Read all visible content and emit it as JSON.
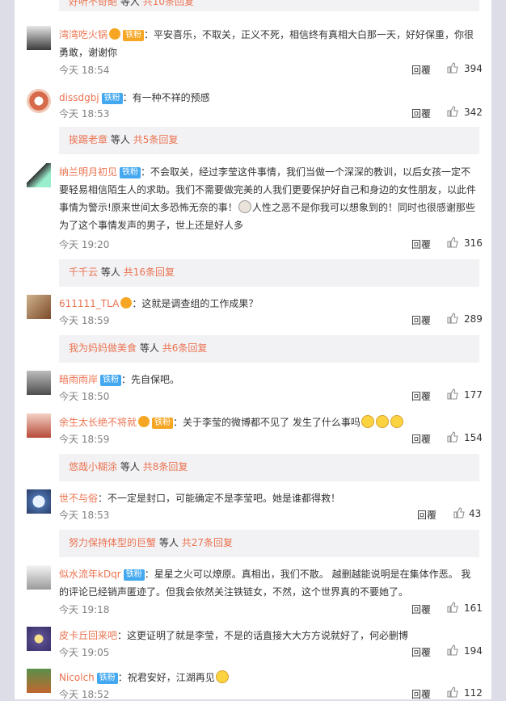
{
  "top_partial": {
    "name": "好听不奇葩",
    "mid": "等人",
    "count": "共10条回复"
  },
  "colors": {
    "accent": "#eb7350",
    "fan_badge": "#43a8f0",
    "gold_badge": "#f6a623"
  },
  "labels": {
    "reply": "回覆",
    "people": "等人"
  },
  "comments": [
    {
      "user": "湾湾吃火锅",
      "badge": "铁粉",
      "text": "：平安喜乐，不取关，正义不死，相信终有真相大白那一天，好好保重，你很勇敢，谢谢你",
      "time": "今天 18:54",
      "likes": "394"
    },
    {
      "user": "dissdgbj",
      "badge": "铁粉",
      "text": "：有一种不祥的预感",
      "time": "今天 18:53",
      "likes": "342"
    },
    {
      "user": "纳兰明月初见",
      "badge": "铁粉",
      "text": "：不会取关，经过李莹这件事情，我们当做一个深深的教训，以后女孩一定不要轻易相信陌生人的求助。我们不需要做完美的人我们更要保护好自己和身边的女性朋友，以此件事情为警示!原来世间太多恐怖无奈的事！",
      "text2": "人性之恶不是你我可以想象到的！同时也很感谢那些为了这个事情发声的男子，世上还是好人多",
      "time": "今天 19:20",
      "likes": "316"
    },
    {
      "user": "611111_TLA",
      "text": "：这就是调查组的工作成果？",
      "time": "今天 18:59",
      "likes": "289"
    },
    {
      "user": "暗雨雨岸",
      "badge": "铁粉",
      "text": "：先自保吧。",
      "time": "今天 18:50",
      "likes": "177"
    },
    {
      "user": "余生太长绝不将就",
      "badge": "铁粉",
      "text": "：关于李莹的微博都不见了 发生了什么事吗",
      "time": "今天 18:59",
      "likes": "154"
    },
    {
      "user": "世不与俗",
      "text": "：不一定是封口，可能确定不是李莹吧。她是谁都得救！",
      "time": "今天 18:53",
      "likes": "43"
    },
    {
      "user": "似水流年kDqr",
      "badge": "铁粉",
      "text": "：星星之火可以燎原。真相出，我们不散。 越删越能说明是在集体作恶。 我的评论已经销声匿迹了。但我会依然关注铁链女，不然，这个世界真的不要她了。",
      "time": "今天 19:18",
      "likes": "161"
    },
    {
      "user": "皮卡丘回来吧",
      "text": "：这更证明了就是李莹，不是的话直接大大方方说就好了，何必删博",
      "time": "今天 19:05",
      "likes": "194"
    },
    {
      "user": "Nicolch",
      "badge": "铁粉",
      "text": "：祝君安好，江湖再见",
      "time": "今天 18:52",
      "likes": "112"
    }
  ],
  "subreplies": [
    {
      "name": "挨踢老章",
      "count": "共5条回复"
    },
    {
      "name": "千千云",
      "count": "共16条回复"
    },
    {
      "name": "我为妈妈做美食",
      "count": "共6条回复"
    },
    {
      "name": "悠哉小糊涂",
      "count": "共8条回复"
    },
    {
      "name": "努力保持体型的巨蟹",
      "count": "共27条回复"
    }
  ]
}
